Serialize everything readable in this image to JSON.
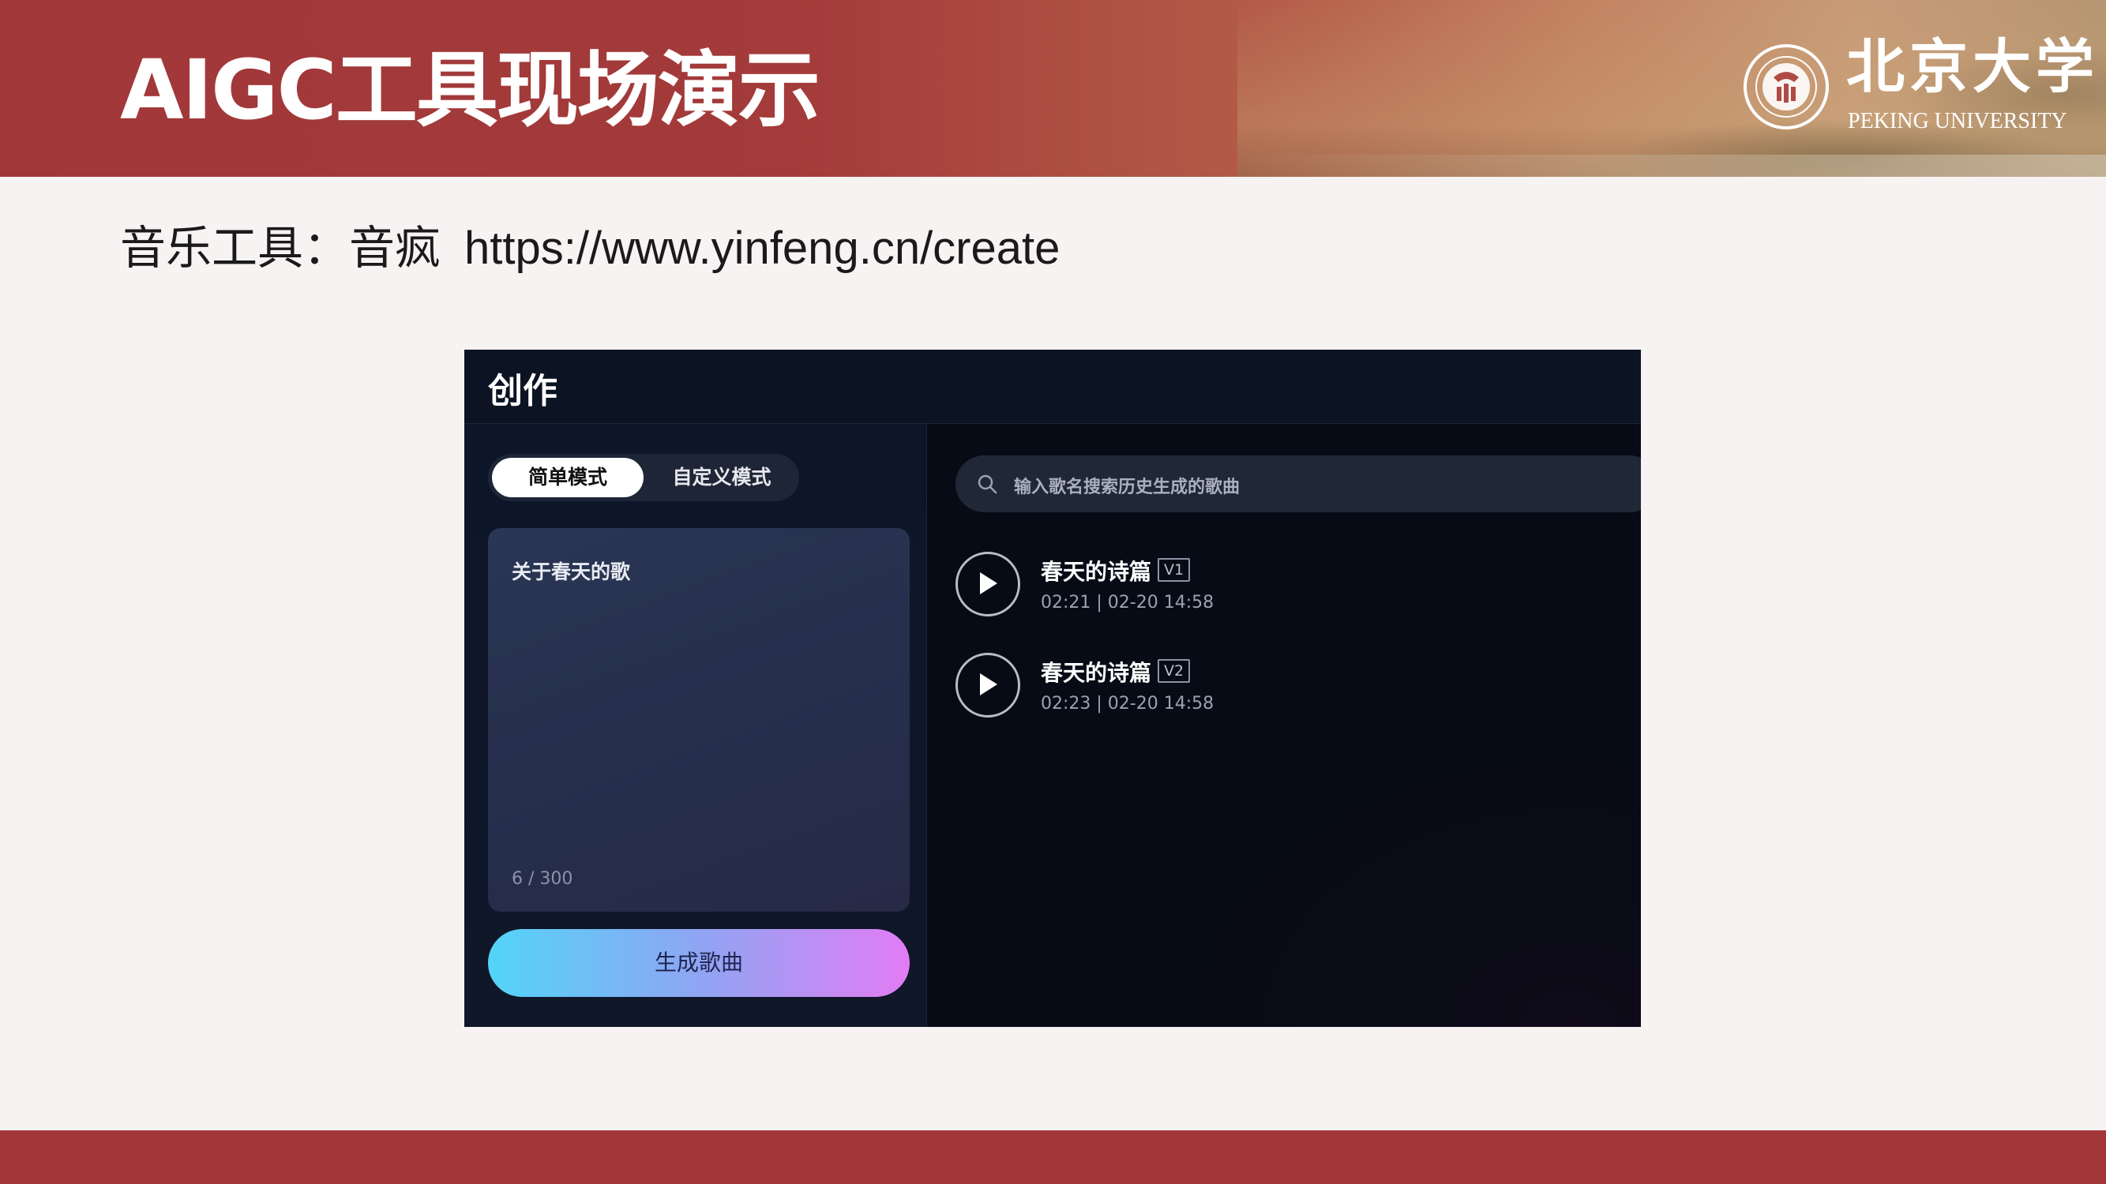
{
  "slide": {
    "title": "AIGC工具现场演示",
    "subtitle_label": "音乐工具：音疯",
    "subtitle_url": "https://www.yinfeng.cn/create",
    "logo_cn": "北京大学",
    "logo_en": "PEKING UNIVERSITY",
    "brand_color": "#a23638"
  },
  "app": {
    "title": "创作",
    "modes": [
      "简单模式",
      "自定义模式"
    ],
    "active_mode": "简单模式",
    "prompt_value": "关于春天的歌",
    "char_counter": "6 / 300",
    "generate_label": "生成歌曲",
    "search_placeholder": "输入歌名搜索历史生成的歌曲",
    "songs": [
      {
        "title": "春天的诗篇",
        "version": "V1",
        "meta": "02:21  |  02-20 14:58"
      },
      {
        "title": "春天的诗篇",
        "version": "V2",
        "meta": "02:23  |  02-20 14:58"
      }
    ]
  }
}
